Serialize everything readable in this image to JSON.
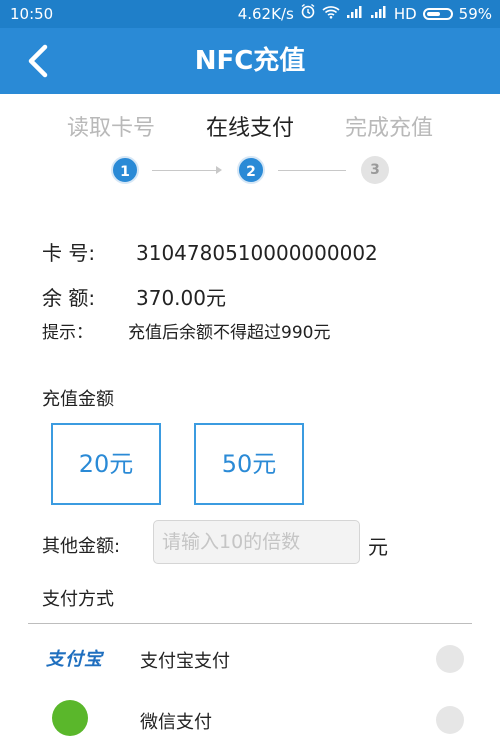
{
  "status_bar": {
    "time": "10:50",
    "speed": "4.62K/s",
    "network": "HD",
    "battery": "59%",
    "battery_level": 0.59
  },
  "app_bar": {
    "title": "NFC充值",
    "back_icon": "chevron-left-icon"
  },
  "steps": [
    {
      "label": "读取卡号",
      "number": "1",
      "state": "done"
    },
    {
      "label": "在线支付",
      "number": "2",
      "state": "active"
    },
    {
      "label": "完成充值",
      "number": "3",
      "state": "pending"
    }
  ],
  "card": {
    "number_label": "卡 号:",
    "number_value": "3104780510000000002",
    "balance_label": "余 额:",
    "balance_value": "370.00元",
    "tip_label": "提示：",
    "tip_value": "充值后余额不得超过990元"
  },
  "recharge": {
    "title": "充值金额",
    "options": [
      "20元",
      "50元"
    ],
    "other_label": "其他金额:",
    "other_placeholder": "请输入10的倍数",
    "other_unit": "元"
  },
  "payment": {
    "title": "支付方式",
    "methods": [
      {
        "logo_text": "支付宝",
        "name": "支付宝支付"
      },
      {
        "name": "微信支付"
      }
    ]
  },
  "colors": {
    "primary": "#2a8ad6",
    "status_bar": "#1f7fc9"
  }
}
